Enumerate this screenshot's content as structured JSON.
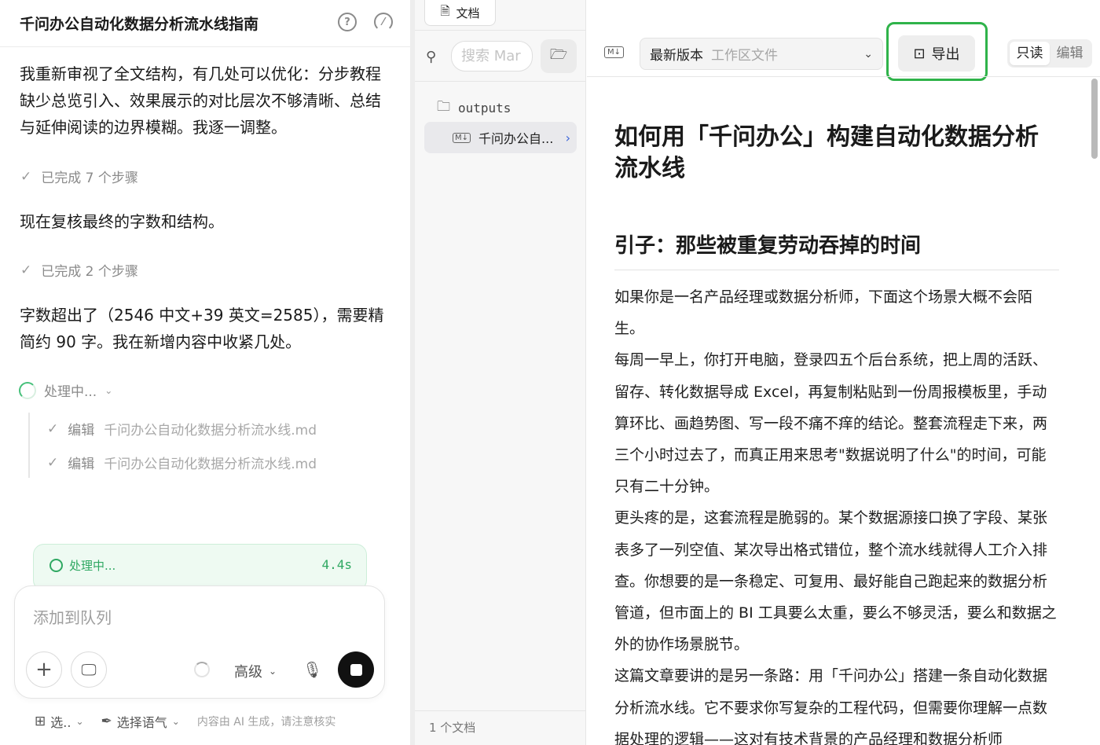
{
  "chat": {
    "title": "千问办公自动化数据分析流水线指南",
    "messages": [
      "我重新审视了全文结构，有几处可以优化：分步教程缺少总览引入、效果展示的对比层次不够清晰、总结与延伸阅读的边界模糊。我逐一调整。",
      "现在复核最终的字数和结构。",
      "字数超出了（2546 中文+39 英文=2585），需要精简约 90 字。我在新增内容中收紧几处。"
    ],
    "steps": [
      "已完成 7 个步骤",
      "已完成 2 个步骤"
    ],
    "processing_label": "处理中...",
    "edits": [
      {
        "action": "编辑",
        "file": "千问办公自动化数据分析流水线.md"
      },
      {
        "action": "编辑",
        "file": "千问办公自动化数据分析流水线.md"
      }
    ],
    "status": {
      "label": "处理中...",
      "time": "4.4s"
    },
    "composer": {
      "placeholder": "添加到队列",
      "level_label": "高级"
    },
    "footer": {
      "select_label": "选..",
      "tone_label": "选择语气",
      "note": "内容由 AI 生成，请注意核实"
    }
  },
  "files": {
    "tab_label": "文档",
    "search_placeholder": "搜索 Mar",
    "folder": "outputs",
    "file": "千问办公自...",
    "count": "1 个文档"
  },
  "document": {
    "version_label": "最新版本",
    "version_sub": "工作区文件",
    "export_label": "导出",
    "mode_readonly": "只读",
    "mode_edit": "编辑",
    "h1": "如何用「千问办公」构建自动化数据分析流水线",
    "h2": "引子：那些被重复劳动吞掉的时间",
    "paragraphs": [
      "如果你是一名产品经理或数据分析师，下面这个场景大概不会陌生。",
      "每周一早上，你打开电脑，登录四五个后台系统，把上周的活跃、留存、转化数据导成 Excel，再复制粘贴到一份周报模板里，手动算环比、画趋势图、写一段不痛不痒的结论。整套流程走下来，两三个小时过去了，而真正用来思考\"数据说明了什么\"的时间，可能只有二十分钟。",
      "更头疼的是，这套流程是脆弱的。某个数据源接口换了字段、某张表多了一列空值、某次导出格式错位，整个流水线就得人工介入排查。你想要的是一条稳定、可复用、最好能自己跑起来的数据分析管道，但市面上的 BI 工具要么太重，要么不够灵活，要么和数据之外的协作场景脱节。",
      "这篇文章要讲的是另一条路：用「千问办公」搭建一条自动化数据分析流水线。它不要求你写复杂的工程代码，但需要你理解一点数据处理的逻辑——这对有技术背景的产品经理和数据分析师"
    ]
  }
}
